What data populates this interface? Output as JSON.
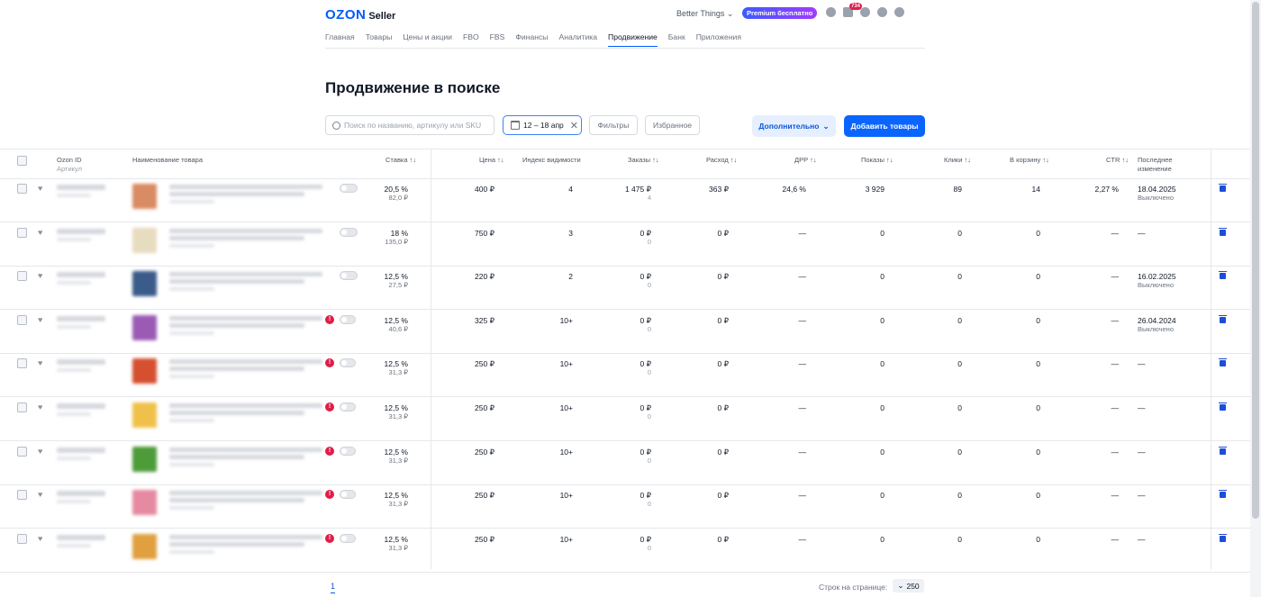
{
  "header": {
    "logo": "OZON",
    "logo_suffix": "Seller",
    "account": "Better Things ⌄",
    "premium": "Premium бесплатно",
    "chat_badge": "734",
    "nav": [
      "Главная",
      "Товары",
      "Цены и акции",
      "FBO",
      "FBS",
      "Финансы",
      "Аналитика",
      "Продвижение",
      "Банк",
      "Приложения"
    ],
    "active_nav": "Продвижение"
  },
  "page": {
    "title": "Продвижение в поиске"
  },
  "toolbar": {
    "search_placeholder": "Поиск по названию, артикулу или SKU",
    "date_range": "12 – 18 апр",
    "filters": "Фильтры",
    "favorites": "Избранное",
    "more": "Дополнительно",
    "add": "Добавить товары"
  },
  "table": {
    "columns": {
      "ozon_id": "Ozon ID",
      "article": "Артикул",
      "name": "Наименование товара",
      "bid": "Ставка ↑↓",
      "price": "Цена ↑↓",
      "visibility": "Индекс видимости",
      "orders": "Заказы ↑↓",
      "spend": "Расход ↑↓",
      "drr": "ДРР ↑↓",
      "shows": "Показы ↑↓",
      "clicks": "Клики ↑↓",
      "cart": "В корзину ↑↓",
      "ctr": "CTR ↑↓",
      "last_change_1": "Последнее",
      "last_change_2": "изменение"
    },
    "rows": [
      {
        "bid": "20,5 %",
        "bid_sub": "82,0 ₽",
        "price": "400 ₽",
        "visibility": "4",
        "orders": "1 475 ₽",
        "orders_sub": "4",
        "spend": "363 ₽",
        "drr": "24,6 %",
        "shows": "3 929",
        "clicks": "89",
        "cart": "14",
        "ctr": "2,27 %",
        "last": "18.04.2025",
        "last_sub": "Выключено",
        "color": "#d98b63"
      },
      {
        "bid": "18 %",
        "bid_sub": "135,0 ₽",
        "price": "750 ₽",
        "visibility": "3",
        "orders": "0 ₽",
        "orders_sub": "0",
        "spend": "0 ₽",
        "drr": "—",
        "shows": "0",
        "clicks": "0",
        "cart": "0",
        "ctr": "—",
        "last": "—",
        "last_sub": "",
        "color": "#e8dcc0"
      },
      {
        "bid": "12,5 %",
        "bid_sub": "27,5 ₽",
        "price": "220 ₽",
        "visibility": "2",
        "orders": "0 ₽",
        "orders_sub": "0",
        "spend": "0 ₽",
        "drr": "—",
        "shows": "0",
        "clicks": "0",
        "cart": "0",
        "ctr": "—",
        "last": "16.02.2025",
        "last_sub": "Выключено",
        "color": "#3b5b8a"
      },
      {
        "bid": "12,5 %",
        "bid_sub": "40,6 ₽",
        "price": "325 ₽",
        "visibility": "10+",
        "orders": "0 ₽",
        "orders_sub": "0",
        "spend": "0 ₽",
        "drr": "—",
        "shows": "0",
        "clicks": "0",
        "cart": "0",
        "ctr": "—",
        "last": "26.04.2024",
        "last_sub": "Выключено",
        "color": "#9b5bb5"
      },
      {
        "bid": "12,5 %",
        "bid_sub": "31,3 ₽",
        "price": "250 ₽",
        "visibility": "10+",
        "orders": "0 ₽",
        "orders_sub": "0",
        "spend": "0 ₽",
        "drr": "—",
        "shows": "0",
        "clicks": "0",
        "cart": "0",
        "ctr": "—",
        "last": "—",
        "last_sub": "",
        "color": "#d5502f"
      },
      {
        "bid": "12,5 %",
        "bid_sub": "31,3 ₽",
        "price": "250 ₽",
        "visibility": "10+",
        "orders": "0 ₽",
        "orders_sub": "0",
        "spend": "0 ₽",
        "drr": "—",
        "shows": "0",
        "clicks": "0",
        "cart": "0",
        "ctr": "—",
        "last": "—",
        "last_sub": "",
        "color": "#f0c14a"
      },
      {
        "bid": "12,5 %",
        "bid_sub": "31,3 ₽",
        "price": "250 ₽",
        "visibility": "10+",
        "orders": "0 ₽",
        "orders_sub": "0",
        "spend": "0 ₽",
        "drr": "—",
        "shows": "0",
        "clicks": "0",
        "cart": "0",
        "ctr": "—",
        "last": "—",
        "last_sub": "",
        "color": "#4e9b3a"
      },
      {
        "bid": "12,5 %",
        "bid_sub": "31,3 ₽",
        "price": "250 ₽",
        "visibility": "10+",
        "orders": "0 ₽",
        "orders_sub": "0",
        "spend": "0 ₽",
        "drr": "—",
        "shows": "0",
        "clicks": "0",
        "cart": "0",
        "ctr": "—",
        "last": "—",
        "last_sub": "",
        "color": "#e58aa0"
      },
      {
        "bid": "12,5 %",
        "bid_sub": "31,3 ₽",
        "price": "250 ₽",
        "visibility": "10+",
        "orders": "0 ₽",
        "orders_sub": "0",
        "spend": "0 ₽",
        "drr": "—",
        "shows": "0",
        "clicks": "0",
        "cart": "0",
        "ctr": "—",
        "last": "—",
        "last_sub": "",
        "color": "#e0a040"
      }
    ]
  },
  "footer": {
    "page": "1",
    "rows_label": "Строк на странице:",
    "rows_value": "250"
  }
}
